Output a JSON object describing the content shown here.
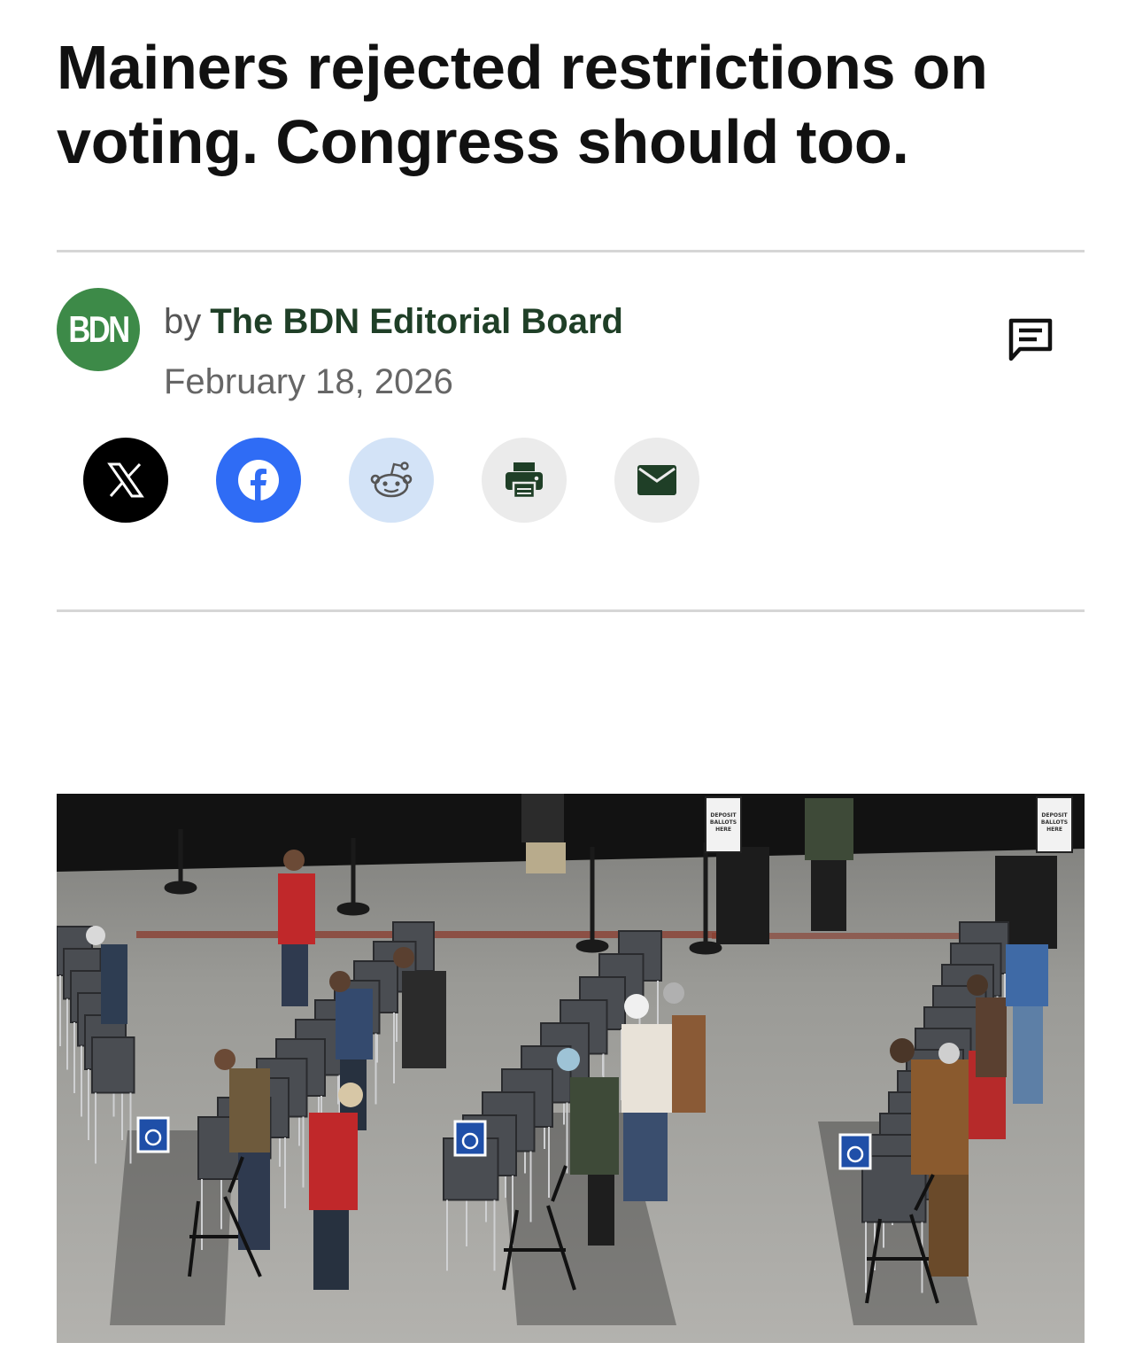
{
  "article": {
    "headline": "Mainers rejected restrictions on voting. Congress should too."
  },
  "byline": {
    "avatar_text": "BDN",
    "prefix": "by",
    "author": "The BDN Editorial Board",
    "date": "February 18, 2026",
    "avatar_color": "#3d8a48",
    "author_color": "#1f3f27"
  },
  "actions": {
    "comment_icon": "comment-icon"
  },
  "share": {
    "buttons": [
      {
        "icon": "x-icon",
        "color": "#000000"
      },
      {
        "icon": "facebook-icon",
        "color": "#2f6cf5"
      },
      {
        "icon": "reddit-icon",
        "color": "#d3e3f7"
      },
      {
        "icon": "print-icon",
        "color": "#ebebeb"
      },
      {
        "icon": "email-icon",
        "color": "#ebebeb"
      }
    ]
  },
  "image": {
    "sign_text": [
      "DEPOSIT",
      "BALLOTS",
      "HERE"
    ]
  }
}
